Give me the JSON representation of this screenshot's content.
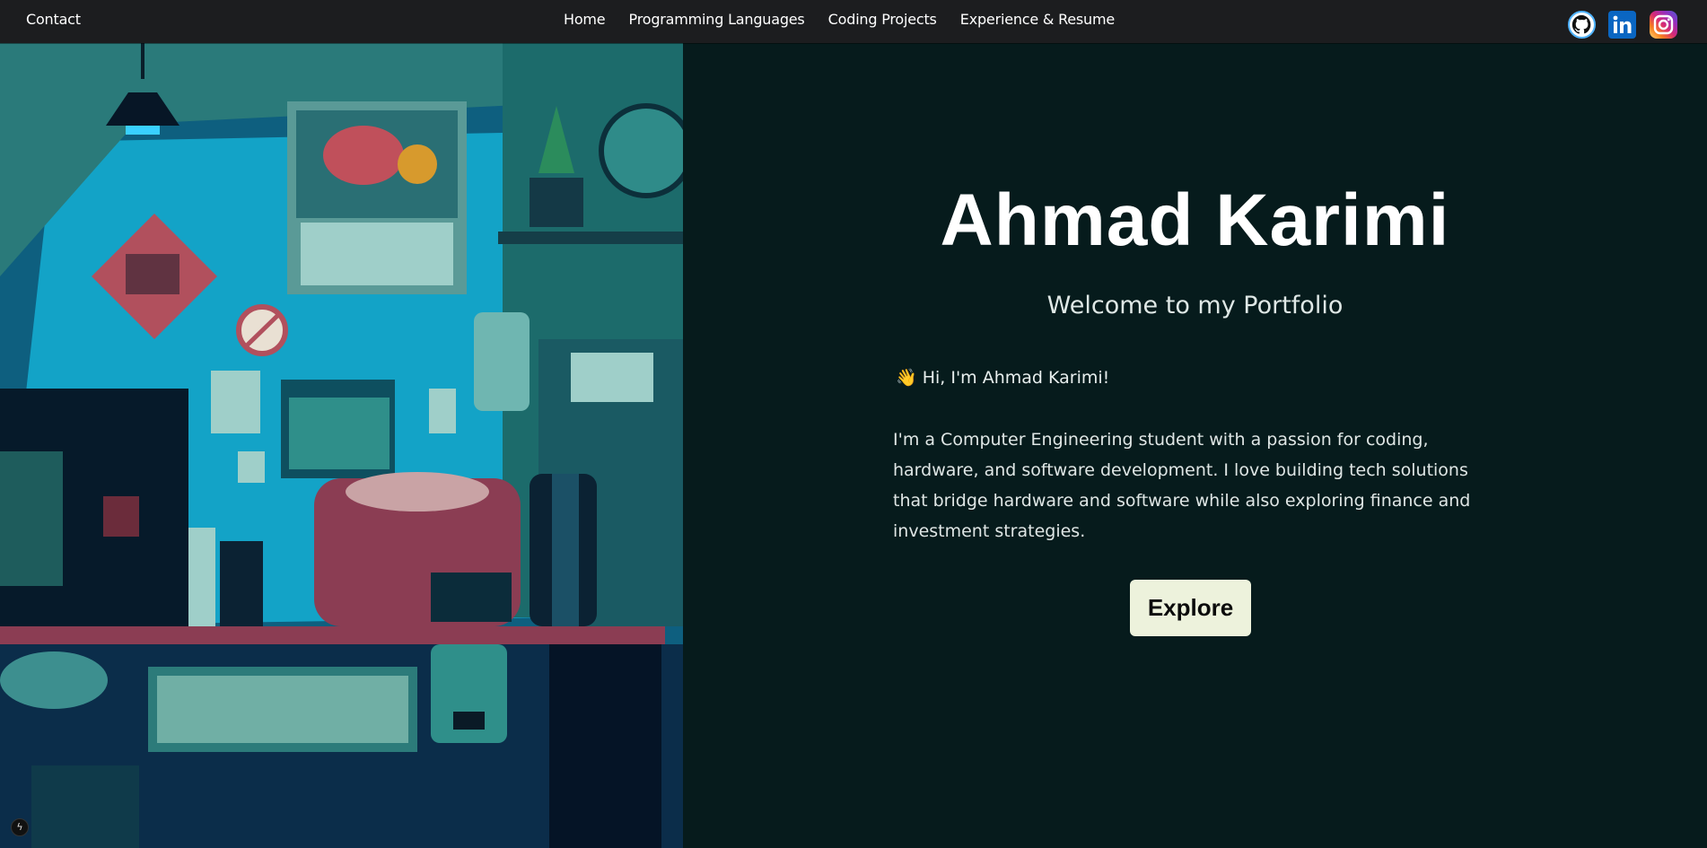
{
  "nav": {
    "contact": "Contact",
    "links": [
      "Home",
      "Programming Languages",
      "Coding Projects",
      "Experience & Resume"
    ],
    "social": [
      "github-icon",
      "linkedin-icon",
      "instagram-icon"
    ]
  },
  "hero": {
    "name": "Ahmad Karimi",
    "welcome": "Welcome to my Portfolio",
    "greeting": "👋 Hi, I'm Ahmad Karimi!",
    "bio": "I'm a Computer Engineering student with a passion for coding, hardware, and software development. I love building tech solutions that bridge hardware and software while also exploring finance and investment strategies.",
    "cta": "Explore"
  },
  "colors": {
    "nav_bg": "#1c1d1f",
    "content_bg": "#061b1c",
    "cta_bg": "#edf2dc",
    "accent": "#0a8fb5"
  }
}
